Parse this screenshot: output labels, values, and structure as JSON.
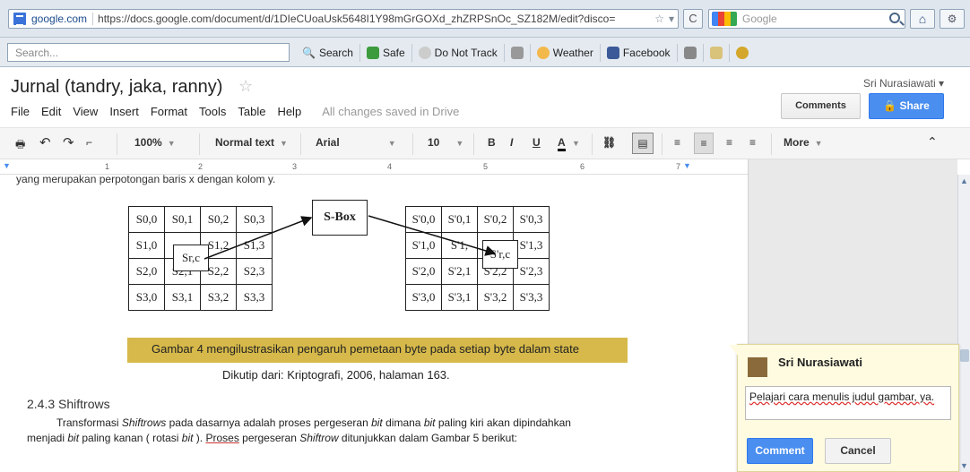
{
  "browser": {
    "domain": "google.com",
    "url": "https://docs.google.com/document/d/1DIeCUoaUsk5648I1Y98mGrGOXd_zhZRPSnOc_SZ182M/edit?disco=",
    "search_placeholder": "Google",
    "reload_symbol": "C",
    "home_symbol": "⌂",
    "star_symbol": "☆"
  },
  "addon_bar": {
    "search_placeholder": "Search...",
    "items": [
      "Search",
      "Safe",
      "Do Not Track",
      "Weather",
      "Facebook"
    ]
  },
  "doc": {
    "title": "Jurnal (tandry, jaka, ranny)",
    "star_symbol": "☆",
    "menu": [
      "File",
      "Edit",
      "View",
      "Insert",
      "Format",
      "Tools",
      "Table",
      "Help"
    ],
    "saved_status": "All changes saved in Drive",
    "user": "Sri Nurasiawati ▾",
    "comments_label": "Comments",
    "share_label": "Share"
  },
  "format_toolbar": {
    "zoom": "100%",
    "style": "Normal text",
    "font": "Arial",
    "size": "10",
    "more": "More"
  },
  "ruler": {
    "marks": [
      "1",
      "2",
      "3",
      "4",
      "5",
      "6",
      "7"
    ]
  },
  "content": {
    "cut_text": "yang merupakan perpotongan baris x dengan kolom y.",
    "table_left": [
      [
        "S0,0",
        "S0,1",
        "S0,2",
        "S0,3"
      ],
      [
        "S1,0",
        "",
        "S1,2",
        "S1,3"
      ],
      [
        "S2,0",
        "S2,1",
        "S2,2",
        "S2,3"
      ],
      [
        "S3,0",
        "S3,1",
        "S3,2",
        "S3,3"
      ]
    ],
    "table_right": [
      [
        "S'0,0",
        "S'0,1",
        "S'0,2",
        "S'0,3"
      ],
      [
        "S'1,0",
        "S'1,",
        "2",
        "S'1,3"
      ],
      [
        "S'2,0",
        "S'2,1",
        "S'2,2",
        "S'2,3"
      ],
      [
        "S'3,0",
        "S'3,1",
        "S'3,2",
        "S'3,3"
      ]
    ],
    "src_box": "Sr,c",
    "sbox_label": "S-Box",
    "dst_box": "S'r,c",
    "caption": "Gambar 4 mengilustrasikan pengaruh pemetaan byte pada setiap byte dalam state",
    "source": "Dikutip dari: Kriptografi, 2006, halaman 163.",
    "heading": "2.4.3 Shiftrows",
    "para1_a": "Transformasi ",
    "para1_b": "Shiftrows",
    "para1_c": " pada dasarnya adalah proses pergeseran ",
    "para1_d": "bit",
    "para1_e": " dimana ",
    "para1_f": "bit",
    "para1_g": " paling kiri akan dipindahkan",
    "para2_a": "menjadi ",
    "para2_b": "bit",
    "para2_c": " paling kanan ( rotasi ",
    "para2_d": "bit",
    "para2_e": " ). ",
    "para2_f": "Proses",
    "para2_g": " pergeseran ",
    "para2_h": "Shiftrow",
    "para2_i": " ditunjukkan dalam Gambar 5 berikut:"
  },
  "comment": {
    "author": "Sri Nurasiawati",
    "text": "Pelajari cara menulis judul gambar, ya.",
    "submit": "Comment",
    "cancel": "Cancel"
  }
}
